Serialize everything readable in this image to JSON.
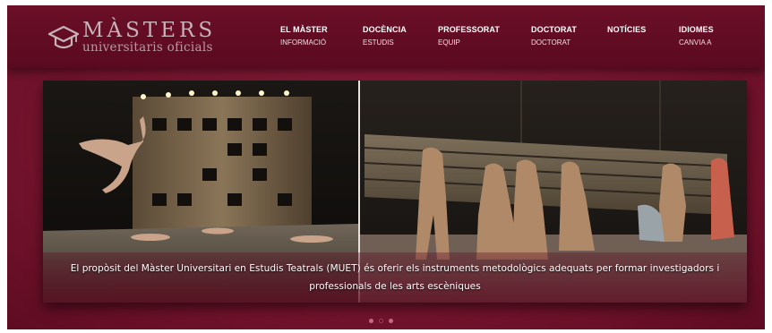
{
  "brand": {
    "title": "MÀSTERS",
    "subtitle": "universitaris oficials",
    "icon": "graduation-cap-icon"
  },
  "nav": [
    {
      "label": "EL MÀSTER",
      "sub": "INFORMACIÓ"
    },
    {
      "label": "DOCÈNCIA",
      "sub": "ESTUDIS"
    },
    {
      "label": "PROFESSORAT",
      "sub": "EQUIP"
    },
    {
      "label": "DOCTORAT",
      "sub": "DOCTORAT"
    },
    {
      "label": "NOTÍCIES",
      "sub": ""
    },
    {
      "label": "IDIOMES",
      "sub": "CANVIA A"
    }
  ],
  "slider": {
    "caption": "El propòsit del Màster Universitari en Estudis Teatrals (MUET) és oferir els instruments metodològics adequats per formar investigadors i professionals de les arts escèniques",
    "slides_total": 3,
    "active_slide": 1
  },
  "colors": {
    "brand_maroon": "#7a1530",
    "header_maroon": "#5e0c22",
    "nav_text": "#ffffff"
  }
}
